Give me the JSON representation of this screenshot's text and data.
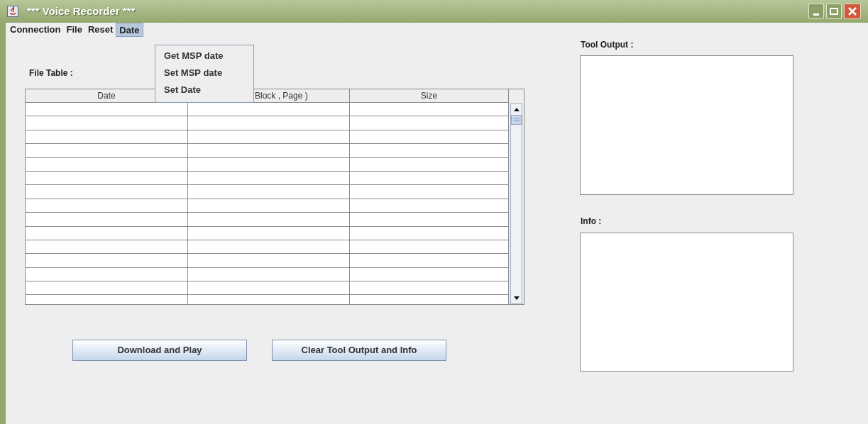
{
  "window": {
    "title": "*** Voice Recorder ***"
  },
  "menu_bar": [
    {
      "label": "Connection",
      "selected": false
    },
    {
      "label": "File",
      "selected": false
    },
    {
      "label": "Reset",
      "selected": false
    },
    {
      "label": "Date",
      "selected": true
    }
  ],
  "open_menu": {
    "items": [
      "Get MSP date",
      "Set MSP date",
      "Set Date"
    ]
  },
  "file_table": {
    "label": "File Table :",
    "columns": [
      "Date",
      "Block , Page )",
      "Size"
    ]
  },
  "buttons": [
    "Download and Play",
    "Clear Tool Output and Info"
  ],
  "tool_output": {
    "label": "Tool Output :"
  },
  "info": {
    "label": "Info :"
  }
}
